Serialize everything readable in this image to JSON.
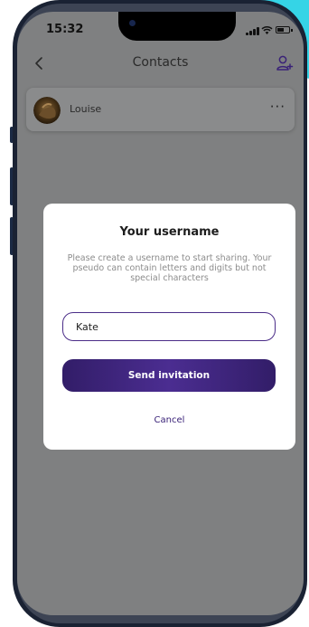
{
  "status_bar": {
    "time": "15:32"
  },
  "navbar": {
    "title": "Contacts"
  },
  "contacts": [
    {
      "name": "Louise",
      "more_label": "···"
    }
  ],
  "modal": {
    "title": "Your username",
    "description": "Please create a username to start sharing. Your pseudo can contain letters and digits but not special characters",
    "input_value": "Kate",
    "send_label": "Send invitation",
    "cancel_label": "Cancel"
  },
  "colors": {
    "accent": "#4b2d91",
    "accent_dark": "#321d68",
    "backdrop": "#35d4e6",
    "dimmed_screen": "#7f8081"
  },
  "icons": {
    "back": "chevron-left-icon",
    "add_contact": "add-user-icon",
    "more": "more-horizontal-icon"
  }
}
